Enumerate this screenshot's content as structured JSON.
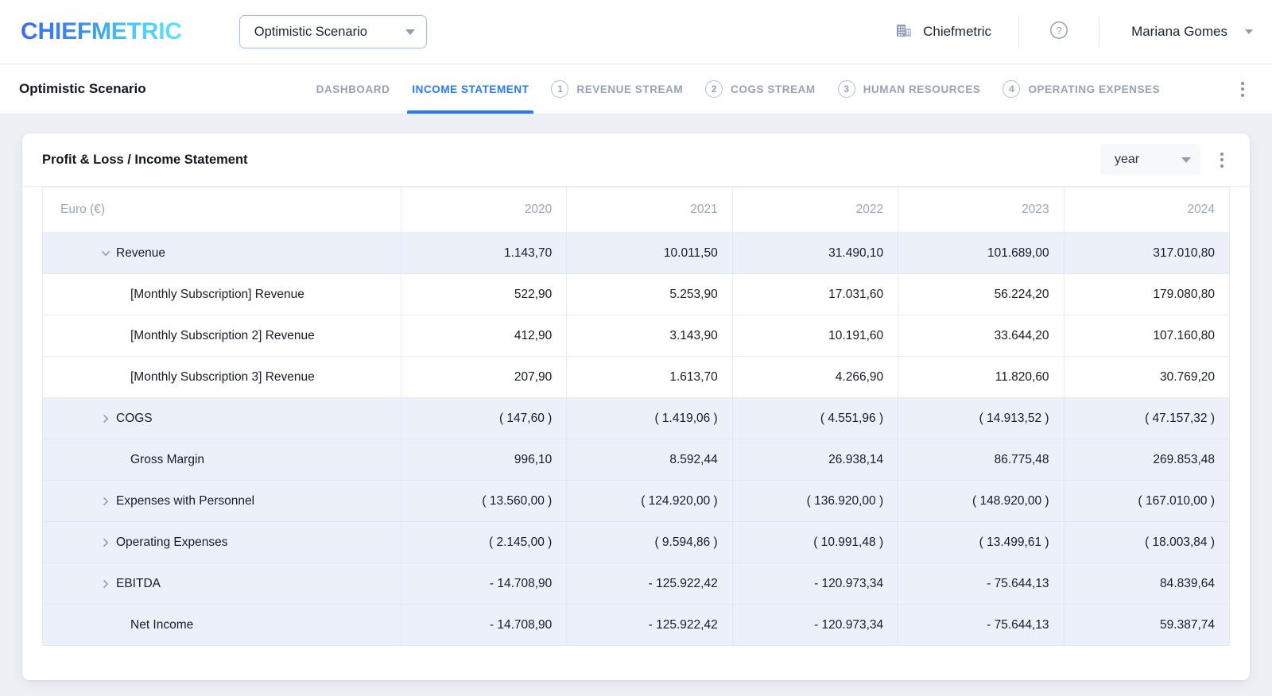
{
  "topbar": {
    "logo_text": "CHIEFMETRIC",
    "scenario_label": "Optimistic Scenario",
    "company_name": "Chiefmetric",
    "company_icon": "building-icon",
    "help_icon": "help-circle-icon",
    "user_name": "Mariana Gomes",
    "user_caret_icon": "chevron-down-icon",
    "scenario_caret_icon": "chevron-down-icon"
  },
  "navbar": {
    "title": "Optimistic Scenario",
    "overflow_icon": "kebab-menu-icon",
    "tabs": [
      {
        "label": "DASHBOARD",
        "num": "",
        "active": false
      },
      {
        "label": "INCOME STATEMENT",
        "num": "",
        "active": true
      },
      {
        "label": "REVENUE STREAM",
        "num": "1",
        "active": false
      },
      {
        "label": "COGS STREAM",
        "num": "2",
        "active": false
      },
      {
        "label": "HUMAN RESOURCES",
        "num": "3",
        "active": false
      },
      {
        "label": "OPERATING EXPENSES",
        "num": "4",
        "active": false
      }
    ]
  },
  "card": {
    "title": "Profit & Loss / Income Statement",
    "period_value": "year",
    "period_caret_icon": "chevron-down-icon",
    "overflow_icon": "kebab-menu-icon"
  },
  "table": {
    "corner_header": "Euro (€)",
    "columns": [
      "2020",
      "2021",
      "2022",
      "2023",
      "2024"
    ],
    "rows": [
      {
        "label": "Revenue",
        "indent": 0,
        "chevron": "chevron-down-icon",
        "expanded": true,
        "shaded": true,
        "values": [
          "1.143,70",
          "10.011,50",
          "31.490,10",
          "101.689,00",
          "317.010,80"
        ]
      },
      {
        "label": "[Monthly Subscription] Revenue",
        "indent": 1,
        "chevron": "",
        "expanded": false,
        "shaded": false,
        "values": [
          "522,90",
          "5.253,90",
          "17.031,60",
          "56.224,20",
          "179.080,80"
        ]
      },
      {
        "label": "[Monthly Subscription 2] Revenue",
        "indent": 1,
        "chevron": "",
        "expanded": false,
        "shaded": false,
        "values": [
          "412,90",
          "3.143,90",
          "10.191,60",
          "33.644,20",
          "107.160,80"
        ]
      },
      {
        "label": "[Monthly Subscription 3] Revenue",
        "indent": 1,
        "chevron": "",
        "expanded": false,
        "shaded": false,
        "values": [
          "207,90",
          "1.613,70",
          "4.266,90",
          "11.820,60",
          "30.769,20"
        ]
      },
      {
        "label": "COGS",
        "indent": 0,
        "chevron": "chevron-right-icon",
        "expanded": false,
        "shaded": true,
        "values": [
          "( 147,60 )",
          "( 1.419,06 )",
          "( 4.551,96 )",
          "( 14.913,52 )",
          "( 47.157,32 )"
        ]
      },
      {
        "label": "Gross Margin",
        "indent": 1,
        "chevron": "",
        "expanded": false,
        "shaded": true,
        "values": [
          "996,10",
          "8.592,44",
          "26.938,14",
          "86.775,48",
          "269.853,48"
        ]
      },
      {
        "label": "Expenses with Personnel",
        "indent": 0,
        "chevron": "chevron-right-icon",
        "expanded": false,
        "shaded": true,
        "values": [
          "( 13.560,00 )",
          "( 124.920,00 )",
          "( 136.920,00 )",
          "( 148.920,00 )",
          "( 167.010,00 )"
        ]
      },
      {
        "label": "Operating Expenses",
        "indent": 0,
        "chevron": "chevron-right-icon",
        "expanded": false,
        "shaded": true,
        "values": [
          "( 2.145,00 )",
          "( 9.594,86 )",
          "( 10.991,48 )",
          "( 13.499,61 )",
          "( 18.003,84 )"
        ]
      },
      {
        "label": "EBITDA",
        "indent": 0,
        "chevron": "chevron-right-icon",
        "expanded": false,
        "shaded": true,
        "values": [
          "- 14.708,90",
          "- 125.922,42",
          "- 120.973,34",
          "- 75.644,13",
          "84.839,64"
        ]
      },
      {
        "label": "Net Income",
        "indent": 1,
        "chevron": "",
        "expanded": false,
        "shaded": true,
        "values": [
          "- 14.708,90",
          "- 125.922,42",
          "- 120.973,34",
          "- 75.644,13",
          "59.387,74"
        ]
      }
    ]
  },
  "colors": {
    "accent": "#2979f2",
    "page_bg": "#eef0f6",
    "row_shade": "#ecf0f9",
    "muted_text": "#97a2b6"
  }
}
